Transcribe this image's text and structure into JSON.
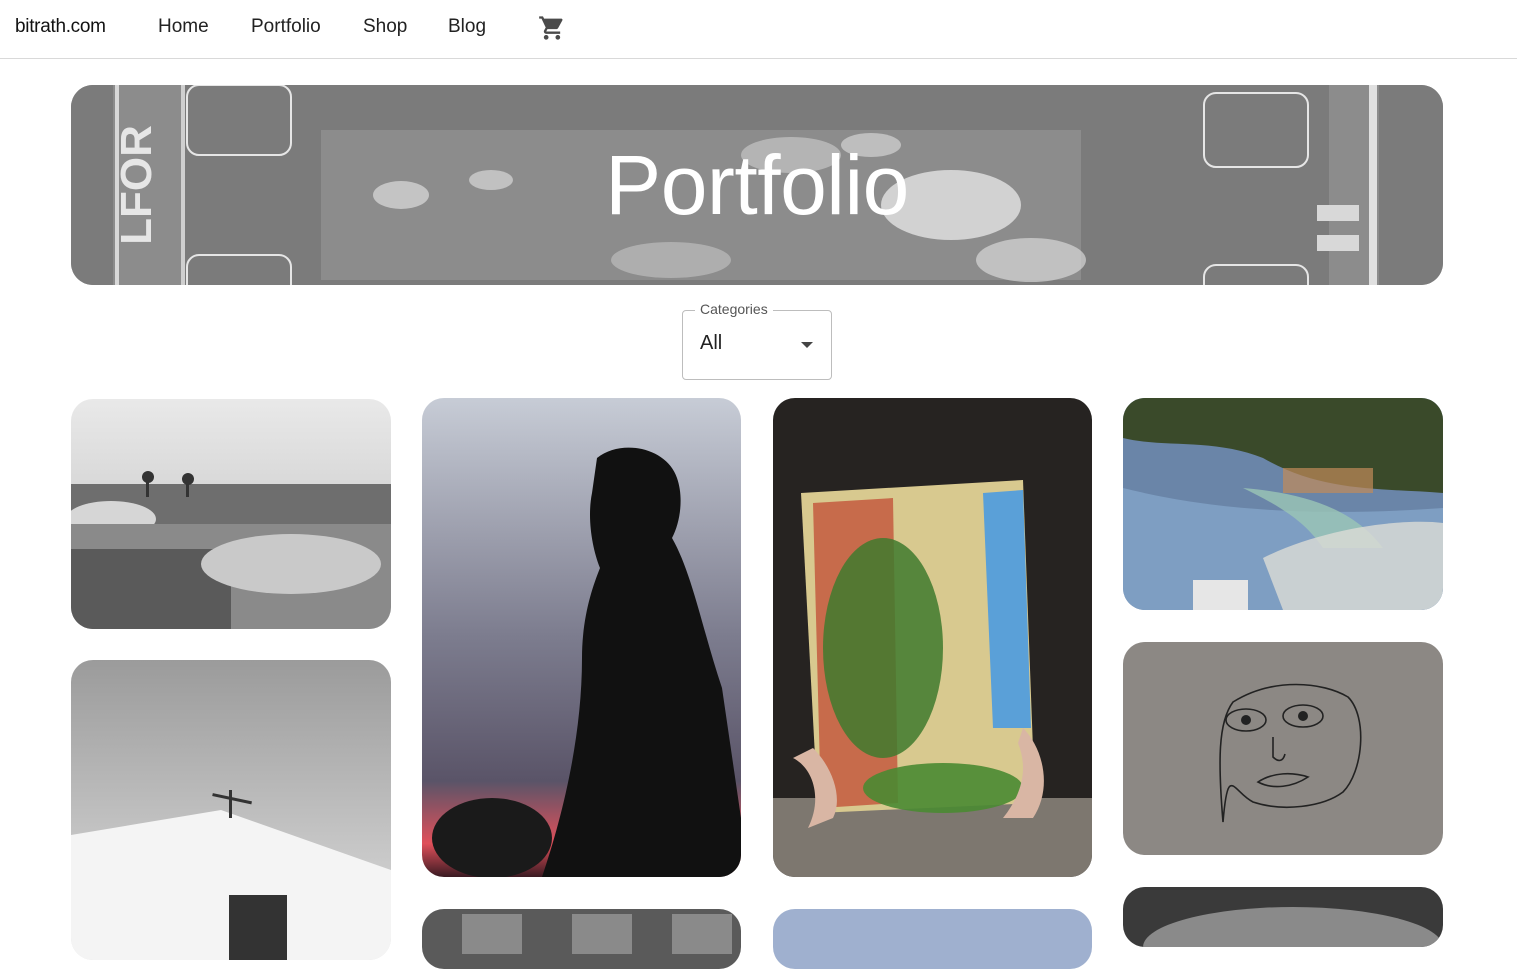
{
  "nav": {
    "brand": "bitrath.com",
    "links": [
      "Home",
      "Portfolio",
      "Shop",
      "Blog"
    ],
    "cart_icon": "shopping-cart-icon"
  },
  "banner": {
    "title": "Portfolio"
  },
  "filter": {
    "label": "Categories",
    "value": "All"
  },
  "gallery": {
    "photos": [
      {
        "subject": "black-and-white beach with umbrellas"
      },
      {
        "subject": "silhouette of man at sunset"
      },
      {
        "subject": "mirror reflecting balconies with plants"
      },
      {
        "subject": "coastal bay with village"
      },
      {
        "subject": "black-and-white chapel with cross"
      },
      {
        "subject": "face drawing on wall"
      }
    ]
  },
  "colors": {
    "background": "#ffffff",
    "text": "#222222",
    "banner_overlay": "#7a7a7a",
    "border": "#d9d9d9"
  }
}
